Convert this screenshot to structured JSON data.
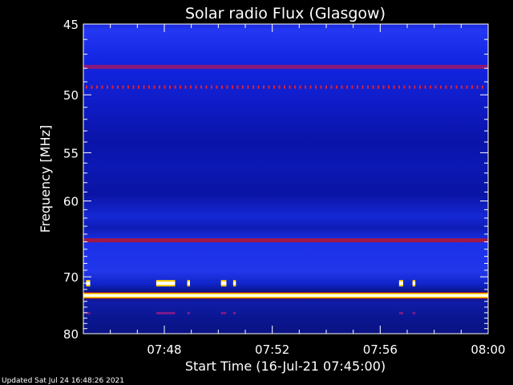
{
  "chart_data": {
    "type": "heatmap",
    "title": "Solar radio Flux (Glasgow)",
    "xlabel": "Start Time (16-Jul-21 07:45:00)",
    "ylabel": "Frequency [MHz]",
    "x_start": "07:45:00",
    "xlim_minutes": [
      0,
      15
    ],
    "xtick_labels": [
      "07:48",
      "07:52",
      "07:56",
      "08:00"
    ],
    "xtick_minutes": [
      3,
      7,
      11,
      15
    ],
    "yscale": "reciprocal",
    "ylim": [
      45,
      80
    ],
    "ytick_labels": [
      "45",
      "50",
      "55",
      "60",
      "70",
      "80"
    ],
    "ytick_values": [
      45,
      50,
      55,
      60,
      70,
      80
    ],
    "continuous_bands_mhz": [
      {
        "freq": 47.9,
        "level": "moderate"
      },
      {
        "freq": 49.4,
        "level": "dotted"
      },
      {
        "freq": 64.8,
        "level": "strong"
      },
      {
        "freq": 73.0,
        "level": "saturated"
      }
    ],
    "bursts": [
      {
        "freq": 71.0,
        "start_min": 0.1,
        "end_min": 0.25
      },
      {
        "freq": 71.0,
        "start_min": 2.7,
        "end_min": 3.4
      },
      {
        "freq": 71.0,
        "start_min": 3.85,
        "end_min": 3.95
      },
      {
        "freq": 71.0,
        "start_min": 5.1,
        "end_min": 5.3
      },
      {
        "freq": 71.0,
        "start_min": 5.55,
        "end_min": 5.65
      },
      {
        "freq": 71.0,
        "start_min": 11.7,
        "end_min": 11.85
      },
      {
        "freq": 71.0,
        "start_min": 12.2,
        "end_min": 12.3
      }
    ],
    "colormap": [
      "#000060",
      "#0a14d8",
      "#2a3cff",
      "#a01060",
      "#ffffff",
      "#ffe000"
    ]
  },
  "footer": {
    "updated_text": "Updated Sat Jul 24 16:48:26 2021"
  }
}
